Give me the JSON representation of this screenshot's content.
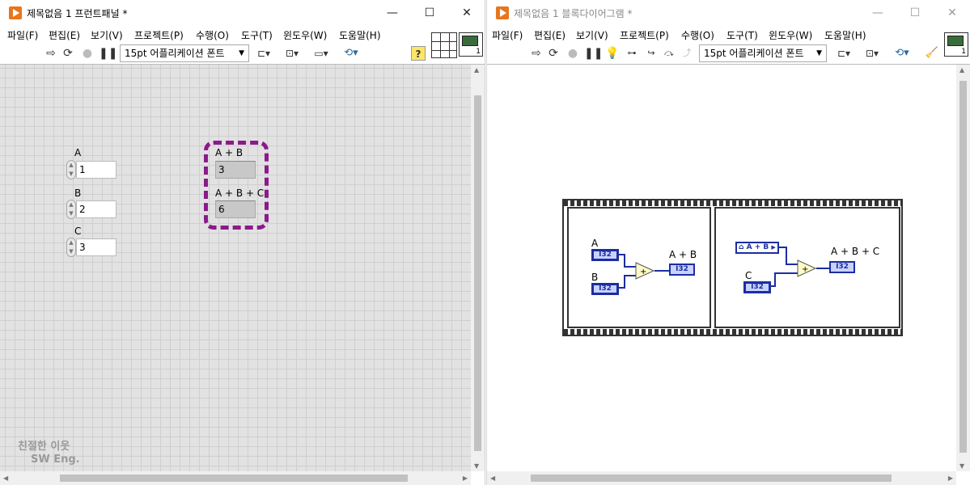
{
  "front_panel": {
    "title": "제목없음 1 프런트패널 *",
    "menu": [
      "파일(F)",
      "편집(E)",
      "보기(V)",
      "프로젝트(P)",
      "수행(O)",
      "도구(T)",
      "윈도우(W)",
      "도움말(H)"
    ],
    "font_select": "15pt 어플리케이션 폰트",
    "controls": [
      {
        "label": "A",
        "value": "1"
      },
      {
        "label": "B",
        "value": "2"
      },
      {
        "label": "C",
        "value": "3"
      }
    ],
    "indicators": [
      {
        "label": "A + B",
        "value": "3"
      },
      {
        "label": "A + B + C",
        "value": "6"
      }
    ],
    "watermark_line1": "친절한 이웃",
    "watermark_line2": "SW Eng.",
    "connector_pane_number": "1"
  },
  "block_diagram": {
    "title": "제목없음 1 블록다이어그램 *",
    "menu": [
      "파일(F)",
      "편집(E)",
      "보기(V)",
      "프로젝트(P)",
      "수행(O)",
      "도구(T)",
      "윈도우(W)",
      "도움말(H)"
    ],
    "font_select": "15pt 어플리케이션 폰트",
    "frame1": {
      "label_a": "A",
      "label_b": "B",
      "label_sum": "A + B",
      "type": "I32",
      "op": "+"
    },
    "frame2": {
      "local_var": "A + B",
      "label_c": "C",
      "label_sum": "A + B + C",
      "type": "I32",
      "op": "+"
    },
    "connector_pane_number": "1"
  },
  "colors": {
    "selection": "#8b1a8b",
    "wire_int": "#1c2ea0",
    "terminal_fill": "#c9d2ff",
    "add_node": "#fffbc8",
    "app_icon": "#e8761d"
  }
}
